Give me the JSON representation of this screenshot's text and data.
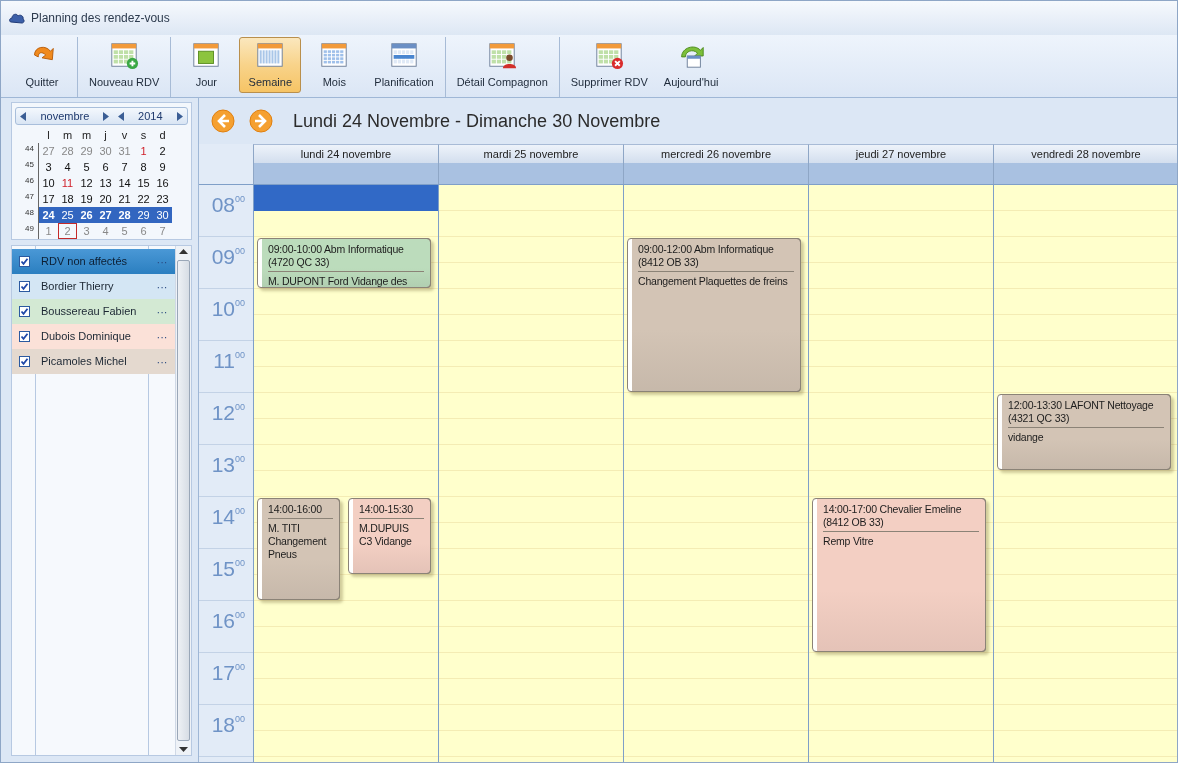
{
  "window": {
    "title": "Planning des rendez-vous"
  },
  "toolbar": {
    "groups": [
      [
        {
          "label": "Quitter",
          "selected": false
        }
      ],
      [
        {
          "label": "Nouveau RDV",
          "selected": false
        }
      ],
      [
        {
          "label": "Jour",
          "selected": false
        },
        {
          "label": "Semaine",
          "selected": true
        },
        {
          "label": "Mois",
          "selected": false
        },
        {
          "label": "Planification",
          "selected": false
        }
      ],
      [
        {
          "label": "Détail Compagnon",
          "selected": false
        }
      ],
      [
        {
          "label": "Supprimer RDV",
          "selected": false
        },
        {
          "label": "Aujourd'hui",
          "selected": false
        }
      ]
    ]
  },
  "mini_calendar": {
    "month": "novembre",
    "year": "2014",
    "weekdays": [
      "l",
      "m",
      "m",
      "j",
      "v",
      "s",
      "d"
    ],
    "weeks": [
      {
        "number": "44",
        "selected": false,
        "days": [
          {
            "d": "27",
            "kind": "outside",
            "bold": false,
            "today": false
          },
          {
            "d": "28",
            "kind": "outside",
            "bold": false,
            "today": false
          },
          {
            "d": "29",
            "kind": "outside",
            "bold": false,
            "today": false
          },
          {
            "d": "30",
            "kind": "outside",
            "bold": false,
            "today": false
          },
          {
            "d": "31",
            "kind": "outside",
            "bold": false,
            "today": false
          },
          {
            "d": "1",
            "kind": "holiday",
            "bold": false,
            "today": false
          },
          {
            "d": "2",
            "kind": "normal",
            "bold": false,
            "today": false
          }
        ]
      },
      {
        "number": "45",
        "selected": false,
        "days": [
          {
            "d": "3",
            "kind": "normal",
            "bold": false,
            "today": false
          },
          {
            "d": "4",
            "kind": "normal",
            "bold": false,
            "today": false
          },
          {
            "d": "5",
            "kind": "normal",
            "bold": false,
            "today": false
          },
          {
            "d": "6",
            "kind": "normal",
            "bold": false,
            "today": false
          },
          {
            "d": "7",
            "kind": "normal",
            "bold": false,
            "today": false
          },
          {
            "d": "8",
            "kind": "normal",
            "bold": false,
            "today": false
          },
          {
            "d": "9",
            "kind": "normal",
            "bold": false,
            "today": false
          }
        ]
      },
      {
        "number": "46",
        "selected": false,
        "days": [
          {
            "d": "10",
            "kind": "normal",
            "bold": false,
            "today": false
          },
          {
            "d": "11",
            "kind": "holiday",
            "bold": false,
            "today": false
          },
          {
            "d": "12",
            "kind": "normal",
            "bold": false,
            "today": false
          },
          {
            "d": "13",
            "kind": "normal",
            "bold": false,
            "today": false
          },
          {
            "d": "14",
            "kind": "normal",
            "bold": false,
            "today": false
          },
          {
            "d": "15",
            "kind": "normal",
            "bold": false,
            "today": false
          },
          {
            "d": "16",
            "kind": "normal",
            "bold": false,
            "today": false
          }
        ]
      },
      {
        "number": "47",
        "selected": false,
        "days": [
          {
            "d": "17",
            "kind": "normal",
            "bold": false,
            "today": false
          },
          {
            "d": "18",
            "kind": "normal",
            "bold": false,
            "today": false
          },
          {
            "d": "19",
            "kind": "normal",
            "bold": false,
            "today": false
          },
          {
            "d": "20",
            "kind": "normal",
            "bold": false,
            "today": false
          },
          {
            "d": "21",
            "kind": "normal",
            "bold": false,
            "today": false
          },
          {
            "d": "22",
            "kind": "normal",
            "bold": false,
            "today": false
          },
          {
            "d": "23",
            "kind": "normal",
            "bold": false,
            "today": false
          }
        ]
      },
      {
        "number": "48",
        "selected": true,
        "days": [
          {
            "d": "24",
            "kind": "normal",
            "bold": true,
            "today": false
          },
          {
            "d": "25",
            "kind": "normal",
            "bold": false,
            "today": false
          },
          {
            "d": "26",
            "kind": "normal",
            "bold": true,
            "today": false
          },
          {
            "d": "27",
            "kind": "normal",
            "bold": true,
            "today": false
          },
          {
            "d": "28",
            "kind": "normal",
            "bold": true,
            "today": false
          },
          {
            "d": "29",
            "kind": "normal",
            "bold": false,
            "today": false
          },
          {
            "d": "30",
            "kind": "normal",
            "bold": false,
            "today": false
          }
        ]
      },
      {
        "number": "49",
        "selected": false,
        "days": [
          {
            "d": "1",
            "kind": "outside",
            "bold": false,
            "today": false
          },
          {
            "d": "2",
            "kind": "outside",
            "bold": false,
            "today": true
          },
          {
            "d": "3",
            "kind": "outside",
            "bold": false,
            "today": false
          },
          {
            "d": "4",
            "kind": "outside",
            "bold": false,
            "today": false
          },
          {
            "d": "5",
            "kind": "outside",
            "bold": false,
            "today": false
          },
          {
            "d": "6",
            "kind": "outside",
            "bold": false,
            "today": false
          },
          {
            "d": "7",
            "kind": "outside",
            "bold": false,
            "today": false
          }
        ]
      }
    ]
  },
  "technicians": [
    {
      "name": "RDV non affectés",
      "checked": true,
      "selected": true,
      "color": "#4a98d6",
      "more": "···"
    },
    {
      "name": "Bordier Thierry",
      "checked": true,
      "selected": false,
      "color": "#d4e6f4",
      "more": "···"
    },
    {
      "name": "Boussereau Fabien",
      "checked": true,
      "selected": false,
      "color": "#d3e9d3",
      "more": "···"
    },
    {
      "name": "Dubois Dominique",
      "checked": true,
      "selected": false,
      "color": "#fbe1d8",
      "more": "···"
    },
    {
      "name": "Picamoles Michel",
      "checked": true,
      "selected": false,
      "color": "#e4d9cf",
      "more": "···"
    }
  ],
  "schedule": {
    "title": "Lundi 24 Novembre - Dimanche 30 Novembre",
    "hours": [
      "08$^{00}$",
      "09$^{00}$",
      "10$^{00}$",
      "11$^{00}$",
      "12$^{00}$",
      "13$^{00}$",
      "14$^{00}$",
      "15$^{00}$",
      "16$^{00}$",
      "17$^{00}$",
      "18$^{00}$"
    ],
    "days": [
      {
        "label": "lundi 24 novembre",
        "first_slot_selected": true,
        "events": [
          {
            "title": "09:00-10:00 Abm Informatique (4720 QC 33)",
            "details": "M. DUPONT Ford Vidange des",
            "color": "#bcdcbc"
          },
          {
            "title": "14:00-16:00",
            "details": "M. TITI Changement Pneus",
            "color": "#d3c4b5"
          },
          {
            "title": "14:00-15:30",
            "details": "M.DUPUIS C3 Vidange",
            "color": "#f3cfc3"
          }
        ]
      },
      {
        "label": "mardi 25 novembre",
        "first_slot_selected": false
      },
      {
        "label": "mercredi 26 novembre",
        "first_slot_selected": false,
        "events": [
          {
            "title": "09:00-12:00 Abm Informatique (8412 OB 33)",
            "details": "Changement Plaquettes de freins",
            "color": "#d3c4b5"
          }
        ]
      },
      {
        "label": "jeudi 27 novembre",
        "first_slot_selected": false,
        "events": [
          {
            "title": "14:00-17:00 Chevalier Emeline (8412 OB 33)",
            "details": "Remp Vitre",
            "color": "#f3cfc3"
          }
        ]
      },
      {
        "label": "vendredi 28 novembre",
        "first_slot_selected": false,
        "events": [
          {
            "title": "12:00-13:30 LAFONT Nettoyage (4321 QC 33)",
            "details": "vidange",
            "color": "#d3c4b5"
          }
        ]
      }
    ]
  }
}
